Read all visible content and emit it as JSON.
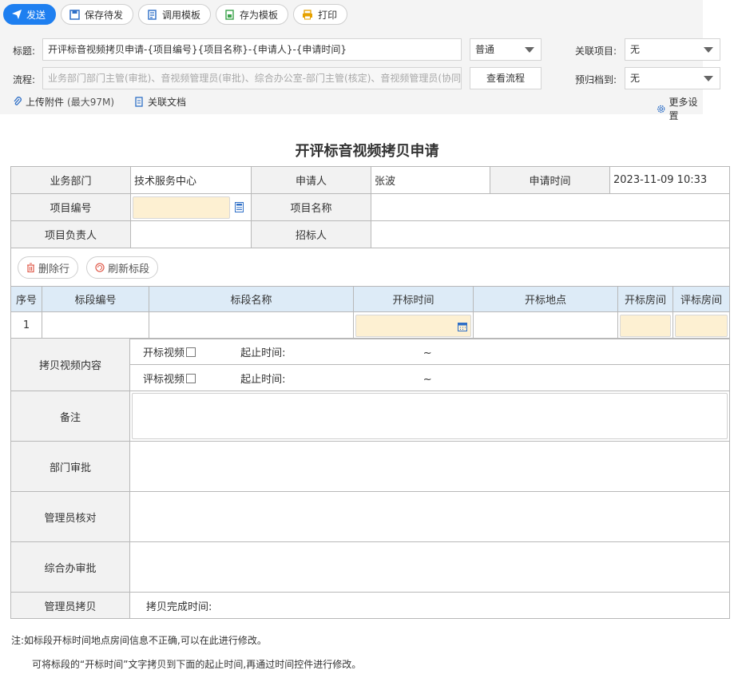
{
  "toolbar": {
    "send": "发送",
    "save_draft": "保存待发",
    "use_template": "调用模板",
    "save_template": "存为模板",
    "print": "打印"
  },
  "form_header": {
    "title_label": "标题:",
    "title_value": "开评标音视频拷贝申请-{项目编号}{项目名称}-{申请人}-{申请时间}",
    "priority": "普通",
    "related_project_label": "关联项目:",
    "related_project_value": "无",
    "flow_label": "流程:",
    "flow_placeholder": "业务部门部门主管(审批)、音视频管理员(审批)、综合办公室-部门主管(核定)、音视频管理员(协同",
    "view_flow": "查看流程",
    "archive_label": "预归档到:",
    "archive_value": "无",
    "upload": "上传附件",
    "upload_limit": "(最大97M)",
    "related_doc": "关联文档",
    "more_settings": "更多设置"
  },
  "form": {
    "title": "开评标音视频拷贝申请",
    "dept_label": "业务部门",
    "dept_value": "技术服务中心",
    "applicant_label": "申请人",
    "applicant_value": "张波",
    "apply_time_label": "申请时间",
    "apply_time_value": "2023-11-09 10:33",
    "project_no_label": "项目编号",
    "project_name_label": "项目名称",
    "project_leader_label": "项目负责人",
    "bidder_label": "招标人",
    "delete_row": "删除行",
    "refresh_section": "刷新标段",
    "columns": [
      "序号",
      "标段编号",
      "标段名称",
      "开标时间",
      "开标地点",
      "开标房间",
      "评标房间"
    ],
    "row_no": "1",
    "copy_content_label": "拷贝视频内容",
    "open_video": "开标视频",
    "eval_video": "评标视频",
    "time_range_label": "起止时间:",
    "tilde": "~",
    "remark_label": "备注",
    "dept_approval_label": "部门审批",
    "admin_check_label": "管理员核对",
    "office_approval_label": "综合办审批",
    "admin_copy_label": "管理员拷贝",
    "copy_done_label": "拷贝完成时间:"
  },
  "notes": {
    "line1": "注:如标段开标时间地点房间信息不正确,可以在此进行修改。",
    "line2": "可将标段的“开标时间”文字拷贝到下面的起止时间,再通过时间控件进行修改。"
  }
}
